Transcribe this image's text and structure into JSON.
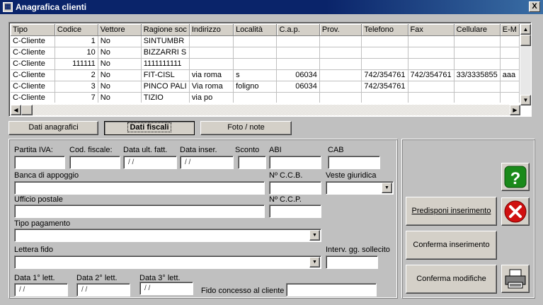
{
  "window": {
    "title": "Anagrafica clienti",
    "close": "X"
  },
  "grid": {
    "columns": [
      "Tipo",
      "Codice",
      "Vettore",
      "Ragione soc",
      "Indirizzo",
      "Località",
      "C.a.p.",
      "Prov.",
      "Telefono",
      "Fax",
      "Cellulare",
      "E-M"
    ],
    "rows": [
      [
        "C-Cliente",
        "1",
        "No",
        "SINTUMBR",
        "",
        "",
        "",
        "",
        "",
        "",
        "",
        ""
      ],
      [
        "C-Cliente",
        "10",
        "No",
        "BIZZARRI S",
        "",
        "",
        "",
        "",
        "",
        "",
        "",
        ""
      ],
      [
        "C-Cliente",
        "111111",
        "No",
        "1111111111",
        "",
        "",
        "",
        "",
        "",
        "",
        "",
        ""
      ],
      [
        "C-Cliente",
        "2",
        "No",
        "FIT-CISL",
        "via roma",
        "s",
        "06034",
        "",
        "742/354761",
        "742/354761",
        "33/3335855",
        "aaa"
      ],
      [
        "C-Cliente",
        "3",
        "No",
        "PINCO PALI",
        "Via roma",
        "foligno",
        "06034",
        "",
        "742/354761",
        "",
        "",
        ""
      ],
      [
        "C-Cliente",
        "7",
        "No",
        "TIZIO",
        "via po",
        "",
        "",
        "",
        "",
        "",
        "",
        ""
      ]
    ]
  },
  "tabs": {
    "anagrafici": "Dati anagrafici",
    "fiscali": "Dati fiscali",
    "foto": "Foto / note"
  },
  "form": {
    "partita_iva": "Partita IVA:",
    "cod_fiscale": "Cod. fiscale:",
    "data_ult_fatt": "Data ult. fatt.",
    "data_inser": "Data inser.",
    "sconto": "Sconto",
    "abi": "ABI",
    "cab": "CAB",
    "banca": "Banca di appoggio",
    "nccb": "Nº C.C.B.",
    "veste": "Veste giuridica",
    "ufficio": "Ufficio postale",
    "nccp": "Nº C.C.P.",
    "tipo_pag": "Tipo pagamento",
    "lettera_fido": "Lettera fido",
    "interv": "Interv. gg. sollecito",
    "data1": "Data 1° lett.",
    "data2": "Data 2° lett.",
    "data3": "Data 3° lett.",
    "fido": "Fido concesso al cliente",
    "date_mask": "/ /"
  },
  "actions": {
    "predisponi": "Predisponi inserimento",
    "conferma_ins": "Conferma inserimento",
    "conferma_mod": "Conferma modifiche"
  },
  "icons": {
    "help": "help-icon",
    "cancel": "cancel-icon",
    "print": "printer-icon"
  },
  "colors": {
    "titlebar": "#0a246a",
    "help": "#1a8a1a",
    "cancel": "#d01010"
  }
}
